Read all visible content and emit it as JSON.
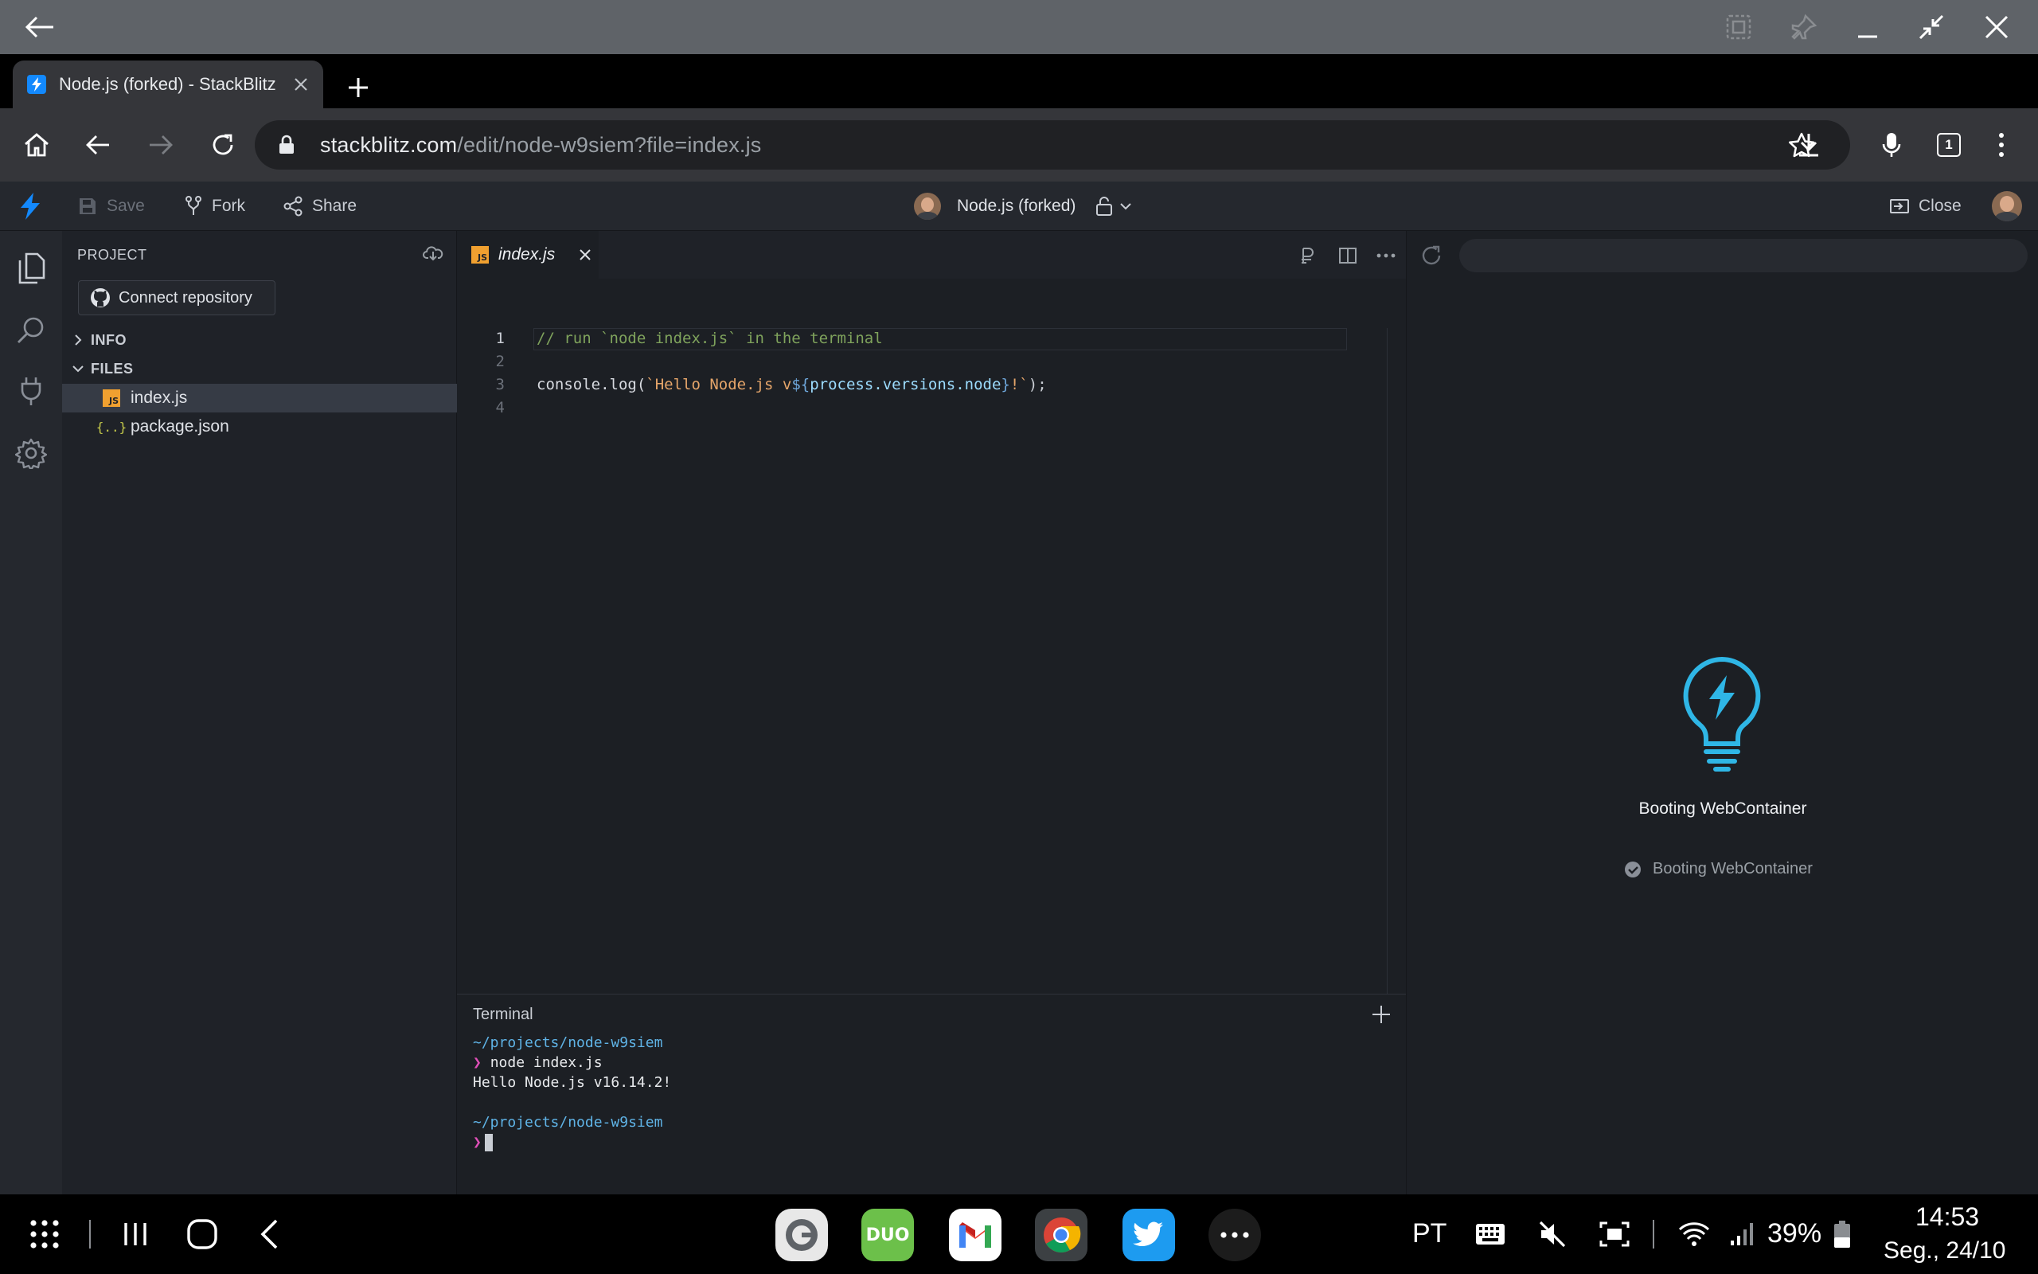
{
  "browser": {
    "tab_title": "Node.js (forked) - StackBlitz",
    "url_host": "stackblitz.com",
    "url_path": "/edit/node-w9siem?file=index.js",
    "tab_count": "1"
  },
  "header": {
    "save_label": "Save",
    "fork_label": "Fork",
    "share_label": "Share",
    "project_title": "Node.js (forked)",
    "close_label": "Close"
  },
  "sidebar": {
    "project_label": "PROJECT",
    "connect_label": "Connect repository",
    "info_label": "INFO",
    "files_label": "FILES",
    "files": [
      {
        "name": "index.js",
        "type": "js"
      },
      {
        "name": "package.json",
        "type": "json"
      }
    ]
  },
  "editor": {
    "active_tab": "index.js",
    "line_numbers": [
      "1",
      "2",
      "3",
      "4"
    ],
    "line1": "// run `node index.js` in the terminal",
    "line3": {
      "fn": "console.log(",
      "str_a": "`Hello Node.js v",
      "tpl_open": "${",
      "expr": "process.versions.node",
      "tpl_close": "}",
      "str_b": "!`",
      "end": ");"
    }
  },
  "terminal": {
    "title": "Terminal",
    "path": "~/projects/node-w9siem",
    "prompt": "❯",
    "command": "node index.js",
    "output": "Hello Node.js v16.14.2!"
  },
  "preview": {
    "status_title": "Booting WebContainer",
    "status_step": "Booting WebContainer"
  },
  "system": {
    "lang": "PT",
    "battery": "39%",
    "time": "14:53",
    "date": "Seg., 24/10"
  },
  "colors": {
    "accent": "#1389fd",
    "bulb": "#2fb6e6",
    "prompt": "#e04fb8",
    "path": "#5fb3e6"
  }
}
